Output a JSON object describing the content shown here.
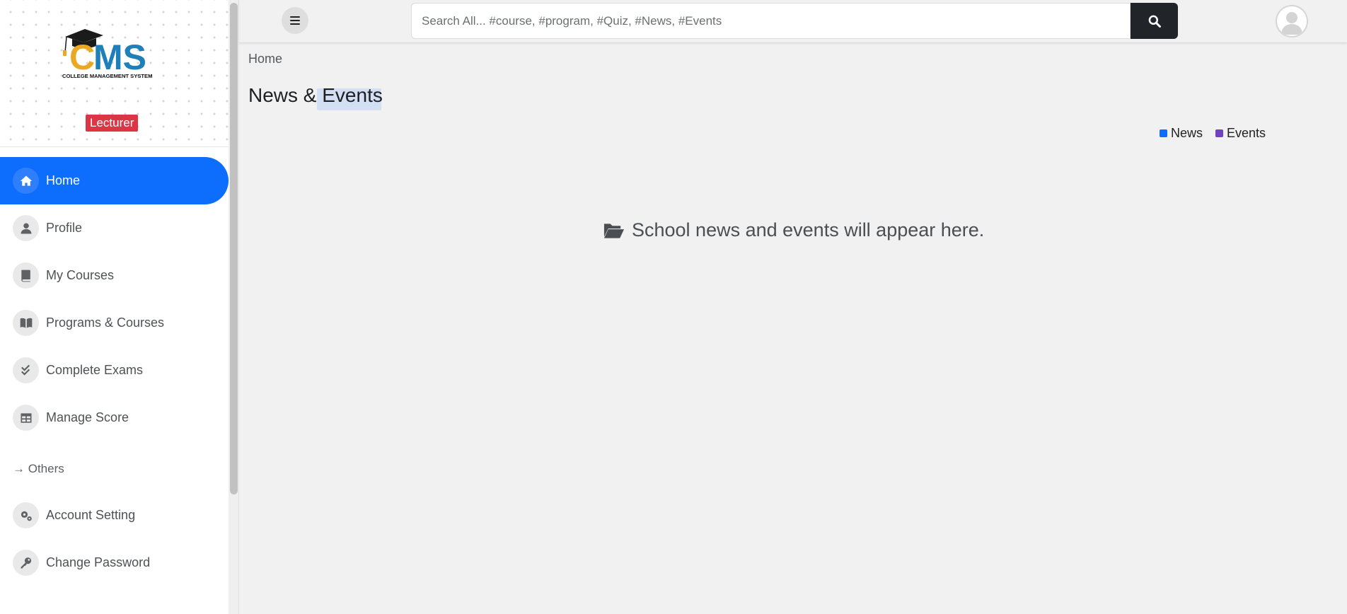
{
  "sidebar": {
    "logo": {
      "text": "CMS",
      "subtitle": "COLLEGE MANAGEMENT SYSTEM"
    },
    "role_badge": "Lecturer",
    "items": [
      {
        "label": "Home",
        "icon": "home-icon",
        "active": true
      },
      {
        "label": "Profile",
        "icon": "user-icon",
        "active": false
      },
      {
        "label": "My Courses",
        "icon": "book-icon",
        "active": false
      },
      {
        "label": "Programs & Courses",
        "icon": "book-open-icon",
        "active": false
      },
      {
        "label": "Complete Exams",
        "icon": "check-double-icon",
        "active": false
      },
      {
        "label": "Manage Score",
        "icon": "table-icon",
        "active": false
      }
    ],
    "section_label": "→ Others",
    "other_items": [
      {
        "label": "Account Setting",
        "icon": "cogs-icon"
      },
      {
        "label": "Change Password",
        "icon": "key-icon"
      }
    ]
  },
  "topbar": {
    "search_placeholder": "Search All... #course, #program, #Quiz, #News, #Events"
  },
  "main": {
    "breadcrumb": "Home",
    "title": "News & Events",
    "legend": [
      {
        "label": "News",
        "color": "#0d6efd"
      },
      {
        "label": "Events",
        "color": "#6f42c1"
      }
    ],
    "empty_message": "School news and events will appear here."
  },
  "colors": {
    "accent": "#0d6efd",
    "badge": "#dc3545",
    "search_button": "#212529"
  }
}
